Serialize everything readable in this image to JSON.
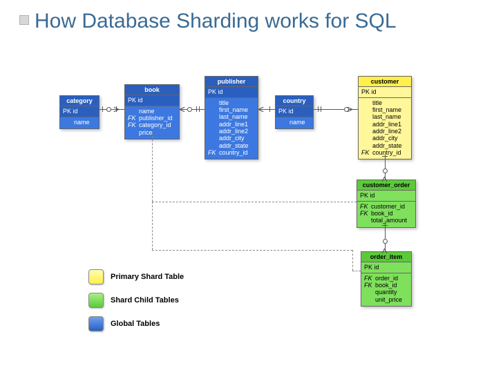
{
  "title": "How Database Sharding works for SQL",
  "legend": {
    "primary": "Primary Shard Table",
    "child": "Shard Child Tables",
    "global": "Global Tables"
  },
  "entities": {
    "category": {
      "name": "category",
      "pk": "PK id",
      "fields": [
        "name"
      ]
    },
    "book": {
      "name": "book",
      "pk": "PK id",
      "fields": [
        "name",
        "FK publisher_id",
        "FK category_id",
        "price"
      ]
    },
    "publisher": {
      "name": "publisher",
      "pk": "PK id",
      "fields": [
        "title",
        "first_name",
        "last_name",
        "addr_line1",
        "addr_line2",
        "addr_city",
        "addr_state",
        "FK country_id"
      ]
    },
    "country": {
      "name": "country",
      "pk": "PK id",
      "fields": [
        "name"
      ]
    },
    "customer": {
      "name": "customer",
      "pk": "PK id",
      "fields": [
        "title",
        "first_name",
        "last_name",
        "addr_line1",
        "addr_line2",
        "addr_city",
        "addr_state",
        "FK country_id"
      ]
    },
    "customer_order": {
      "name": "customer_order",
      "pk": "PK id",
      "fields": [
        "FK customer_id",
        "FK book_id",
        "total_amount"
      ]
    },
    "order_item": {
      "name": "order_item",
      "pk": "PK id",
      "fields": [
        "FK order_id",
        "FK book_id",
        "quantity",
        "unit_price"
      ]
    }
  }
}
